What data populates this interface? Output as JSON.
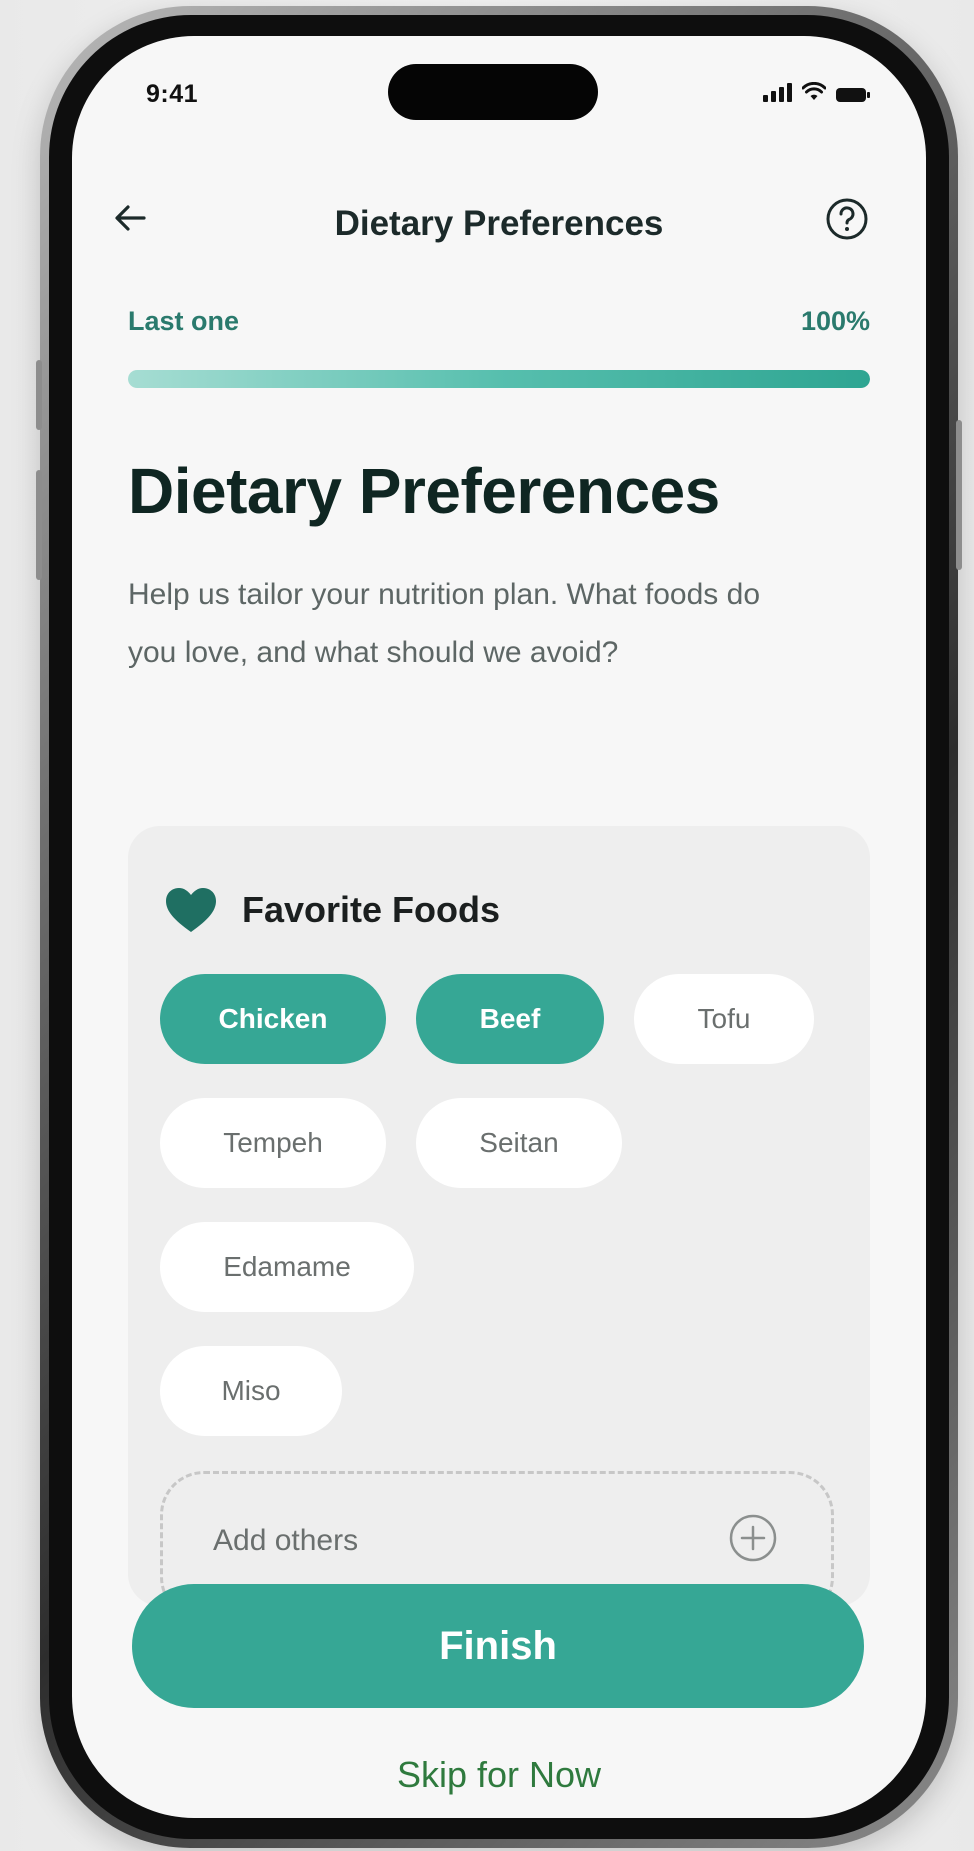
{
  "status_bar": {
    "time": "9:41"
  },
  "nav": {
    "title": "Dietary Preferences",
    "back_icon": "arrow-left-icon",
    "help_icon": "question-circle-icon"
  },
  "progress": {
    "label": "Last one",
    "percent_label": "100%",
    "value": 1.0
  },
  "page": {
    "heading": "Dietary Preferences",
    "subtitle": "Help us tailor your nutrition plan. What foods do you love, and what should we avoid?"
  },
  "favorites": {
    "title": "Favorite Foods",
    "icon": "heart-icon",
    "chips": [
      {
        "label": "Chicken",
        "selected": true
      },
      {
        "label": "Beef",
        "selected": true
      },
      {
        "label": "Tofu",
        "selected": false
      },
      {
        "label": "Tempeh",
        "selected": false
      },
      {
        "label": "Seitan",
        "selected": false
      },
      {
        "label": "Edamame",
        "selected": false
      },
      {
        "label": "Miso",
        "selected": false
      }
    ],
    "add_placeholder": "Add others",
    "add_icon": "plus-circle-icon"
  },
  "actions": {
    "finish_label": "Finish",
    "skip_label": "Skip for Now"
  },
  "colors": {
    "accent": "#36a795",
    "heading": "#0f2622",
    "progress_text": "#2a7a6d",
    "skip_text": "#2f7a3e"
  }
}
